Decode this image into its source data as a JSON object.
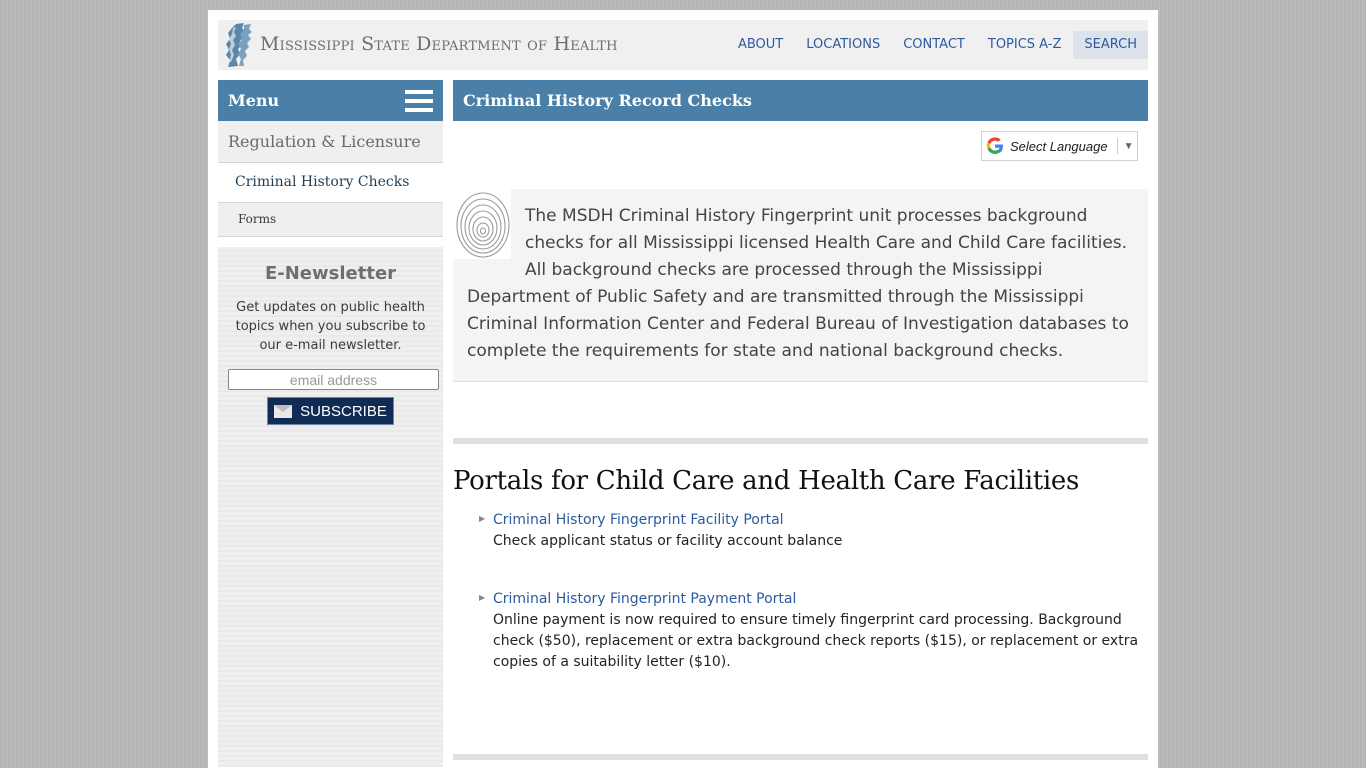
{
  "header": {
    "site_title": "Mississippi State Department of Health",
    "nav": [
      {
        "label": "ABOUT"
      },
      {
        "label": "LOCATIONS"
      },
      {
        "label": "CONTACT"
      },
      {
        "label": "TOPICS A-Z"
      },
      {
        "label": "SEARCH"
      }
    ]
  },
  "sidebar": {
    "menu_label": "Menu",
    "items": [
      {
        "label": "Regulation & Licensure"
      },
      {
        "label": "Criminal History Checks"
      },
      {
        "label": "Forms"
      }
    ],
    "newsletter": {
      "title": "E-Newsletter",
      "description": "Get updates on public health topics when you subscribe to our e-mail newsletter.",
      "email_placeholder": "email address",
      "email_value": "",
      "subscribe_label": "SUBSCRIBE"
    }
  },
  "main": {
    "page_title": "Criminal History Record Checks",
    "language_select": "Select Language",
    "intro": "The MSDH Criminal History Fingerprint unit processes background checks for all Mississippi licensed Health Care and Child Care facilities. All background checks are processed through the Mississippi Department of Public Safety and are transmitted through the Mississippi Criminal Information Center and Federal Bureau of Investigation databases to complete the requirements for state and national background checks.",
    "section_title": "Portals for Child Care and Health Care Facilities",
    "portals": [
      {
        "link": "Criminal History Fingerprint Facility Portal",
        "description": "Check applicant status or facility account balance"
      },
      {
        "link": "Criminal History Fingerprint Payment Portal",
        "description": "Online payment is now required to ensure timely fingerprint card processing. Background check ($50), replacement or extra background check reports ($15), or replacement or extra copies of a suitability letter ($10)."
      }
    ]
  },
  "colors": {
    "brand_blue": "#4a80a8",
    "link_blue": "#2c5aa0",
    "subscribe_navy": "#102c55"
  }
}
